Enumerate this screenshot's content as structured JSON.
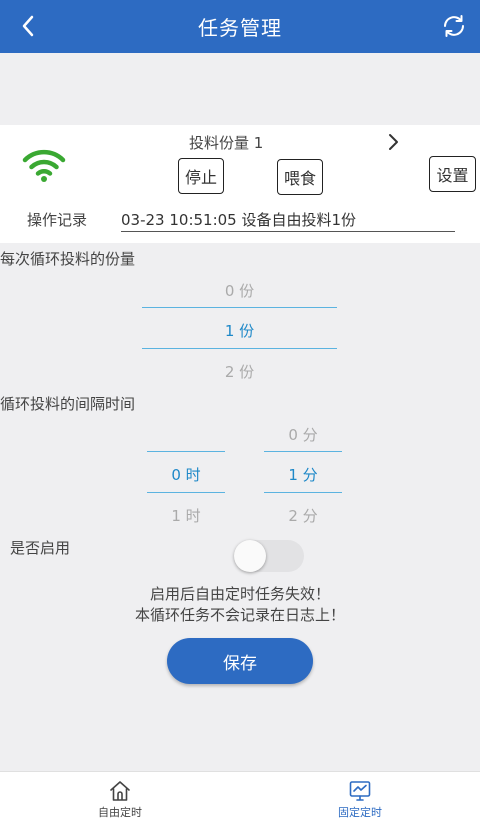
{
  "header": {
    "title": "任务管理",
    "back_icon": "chevron-left-icon",
    "refresh_icon": "refresh-icon"
  },
  "device": {
    "wifi_icon": "wifi-icon",
    "portion_label": "投料份量 1",
    "stop_label": "停止",
    "feed_label": "喂食",
    "settings_label": "设置",
    "log_label": "操作记录",
    "log_value": "03-23 10:51:05 设备自由投料1份"
  },
  "portion_picker": {
    "label": "每次循环投料的份量",
    "items": [
      "0 份",
      "1 份",
      "2 份"
    ],
    "selected": "1 份"
  },
  "interval_picker": {
    "label": "循环投料的间隔时间",
    "hours": {
      "items": [
        "0 时",
        "1 时"
      ],
      "selected": "0 时"
    },
    "minutes": {
      "items": [
        "0 分",
        "1 分",
        "2 分"
      ],
      "selected": "1 分"
    }
  },
  "enable": {
    "label": "是否启用",
    "enabled": false
  },
  "notes": {
    "line1": "启用后自由定时任务失效！",
    "line2": "本循环任务不会记录在日志上！"
  },
  "save_label": "保存",
  "bottom_nav": {
    "items": [
      {
        "label": "自由定时",
        "icon": "home-icon",
        "active": false
      },
      {
        "label": "固定定时",
        "icon": "monitor-chart-icon",
        "active": true
      }
    ]
  },
  "colors": {
    "primary": "#2d6bc2",
    "accent": "#1e88c8",
    "wifi": "#3aa832",
    "background": "#efeff1"
  }
}
